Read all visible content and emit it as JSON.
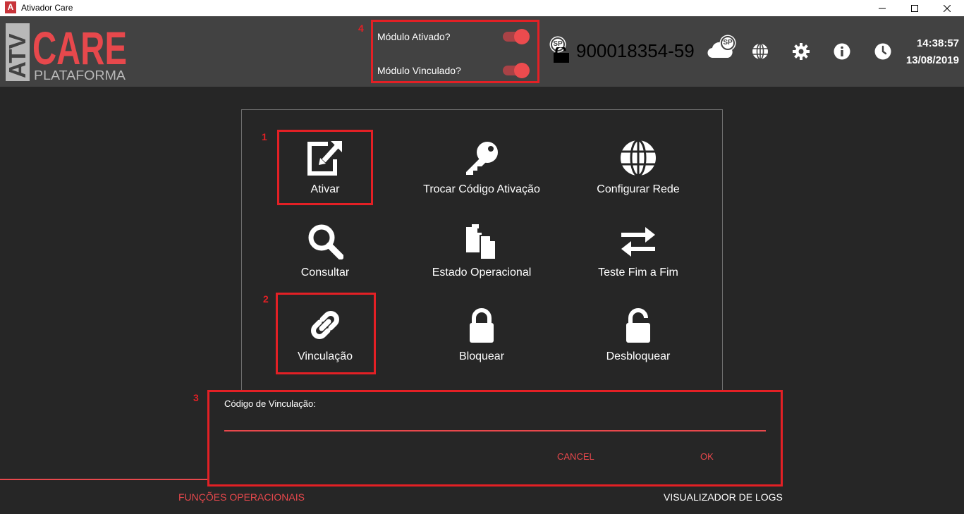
{
  "window": {
    "title": "Ativador Care",
    "app_icon_letter": "A",
    "controls": [
      "minimize-icon",
      "maximize-icon",
      "close-icon"
    ]
  },
  "header": {
    "logo": {
      "left_text": "ATV",
      "main_text": "CARE",
      "sub_text": "PLATAFORMA"
    },
    "toggles": [
      {
        "label": "Módulo Ativado?",
        "on": true
      },
      {
        "label": "Módulo Vinculado?",
        "on": true
      }
    ],
    "state_badge": "SP",
    "serial": "900018354-59",
    "cloud_badge": "SP",
    "icons": [
      "cloud-icon",
      "globe-icon",
      "gear-icon",
      "info-icon",
      "clock-icon"
    ],
    "time": "14:38:57",
    "date": "13/08/2019"
  },
  "callouts": {
    "c1": "1",
    "c2": "2",
    "c3": "3",
    "c4": "4"
  },
  "menu": [
    {
      "label": "Ativar",
      "icon": "edit-icon"
    },
    {
      "label": "Trocar Código Ativação",
      "icon": "key-icon"
    },
    {
      "label": "Configurar Rede",
      "icon": "globe-icon"
    },
    {
      "label": "Consultar",
      "icon": "search-icon"
    },
    {
      "label": "Estado Operacional",
      "icon": "copy-icon"
    },
    {
      "label": "Teste Fim a Fim",
      "icon": "exchange-icon"
    },
    {
      "label": "Vinculação",
      "icon": "link-icon"
    },
    {
      "label": "Bloquear",
      "icon": "lock-icon"
    },
    {
      "label": "Desbloquear",
      "icon": "unlock-icon"
    }
  ],
  "dialog": {
    "label": "Código de Vinculação:",
    "value": "",
    "cancel": "CANCEL",
    "ok": "OK"
  },
  "tabs": [
    {
      "label": "FUNÇÕES OPERACIONAIS",
      "active": true
    },
    {
      "label": "VISUALIZADOR DE LOGS",
      "active": false
    }
  ],
  "colors": {
    "accent": "#e7484c",
    "highlight": "#e32025",
    "background": "#262626",
    "header": "#424242"
  }
}
